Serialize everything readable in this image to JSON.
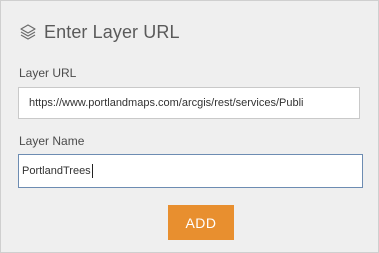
{
  "header": {
    "title": "Enter Layer URL",
    "icon": "layers-icon"
  },
  "layer_url": {
    "label": "Layer URL",
    "value": "https://www.portlandmaps.com/arcgis/rest/services/Publi"
  },
  "layer_name": {
    "label": "Layer Name",
    "value": "PortlandTrees"
  },
  "add_button": {
    "label": "ADD",
    "color": "#e88f2f"
  },
  "colors": {
    "panel_bg": "#efefef",
    "focus_border": "#6d8cb2",
    "text": "#5a5a5a"
  }
}
